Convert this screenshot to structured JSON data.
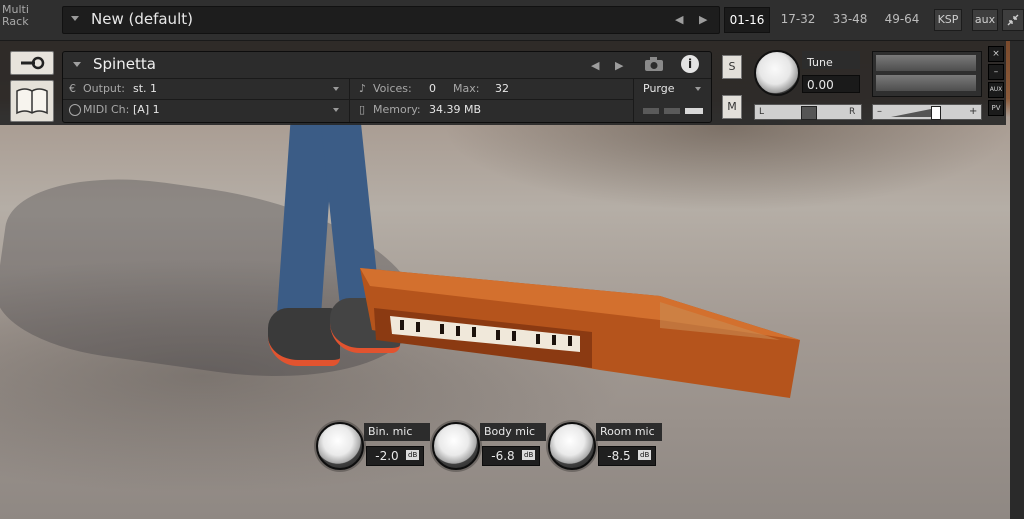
{
  "topbar": {
    "multi_rack_label_1": "Multi",
    "multi_rack_label_2": "Rack",
    "preset_name": "New (default)",
    "tabs": [
      "01-16",
      "17-32",
      "33-48",
      "49-64"
    ],
    "active_tab": "01-16",
    "ksp_label": "KSP",
    "aux_label": "aux",
    "nav_prev": "◀",
    "nav_next": "▶",
    "collapse_icon": "collapse-arrows-icon"
  },
  "instrument": {
    "name": "Spinetta",
    "output_label": "Output:",
    "output_value": "st. 1",
    "midi_label": "MIDI Ch:",
    "midi_value": "[A]  1",
    "voices_label": "Voices:",
    "voices_value": "0",
    "max_label": "Max:",
    "max_value": "32",
    "memory_label": "Memory:",
    "memory_value": "34.39 MB",
    "purge_label": "Purge",
    "solo_label": "S",
    "mute_label": "M",
    "tune_label": "Tune",
    "tune_value": "0.00",
    "pan_left": "L",
    "pan_right": "R",
    "vol_minus": "–",
    "vol_plus": "+",
    "side_close": "×",
    "side_min": "–",
    "side_aux": "AUX",
    "side_pv": "PV"
  },
  "mics": [
    {
      "name": "Bin. mic",
      "value": "-2.0",
      "unit": "dB"
    },
    {
      "name": "Body mic",
      "value": "-6.8",
      "unit": "dB"
    },
    {
      "name": "Room mic",
      "value": "-8.5",
      "unit": "dB"
    }
  ],
  "colors": {
    "accent": "#e8e8e8",
    "panel": "#2c2c2c"
  }
}
